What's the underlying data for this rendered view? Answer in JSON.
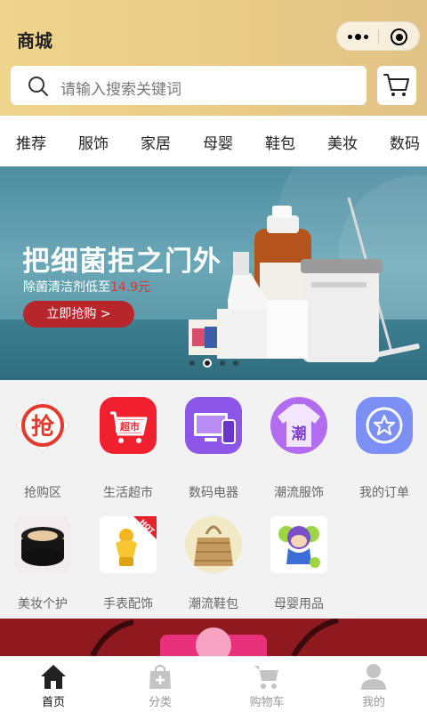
{
  "header": {
    "title": "商城"
  },
  "search": {
    "placeholder": "请输入搜索关键词"
  },
  "tabs": [
    "推荐",
    "服饰",
    "家居",
    "母婴",
    "鞋包",
    "美妆",
    "数码"
  ],
  "banner": {
    "headline": "把细菌拒之门外",
    "subtitle_prefix": "除菌清洁剂低至",
    "price": "14.9元",
    "button": "立即抢购 >",
    "active_dot": 2,
    "dot_count": 4
  },
  "categories": [
    {
      "label": "抢购区",
      "icon": "flash-sale-icon"
    },
    {
      "label": "生活超市",
      "icon": "supermarket-icon"
    },
    {
      "label": "数码电器",
      "icon": "electronics-icon"
    },
    {
      "label": "潮流服饰",
      "icon": "fashion-icon"
    },
    {
      "label": "我的订单",
      "icon": "orders-icon"
    },
    {
      "label": "美妆个护",
      "icon": "cosmetics-icon"
    },
    {
      "label": "手表配饰",
      "icon": "accessories-icon"
    },
    {
      "label": "潮流鞋包",
      "icon": "bags-icon"
    },
    {
      "label": "母婴用品",
      "icon": "baby-icon"
    }
  ],
  "tabbar": [
    {
      "label": "首页",
      "icon": "home-icon",
      "active": true
    },
    {
      "label": "分类",
      "icon": "category-bag-icon",
      "active": false
    },
    {
      "label": "购物车",
      "icon": "cart-icon",
      "active": false
    },
    {
      "label": "我的",
      "icon": "user-icon",
      "active": false
    }
  ],
  "colors": {
    "header_gold": "#e9cc86",
    "banner_button": "#b7262b",
    "price_red": "#e03434"
  }
}
